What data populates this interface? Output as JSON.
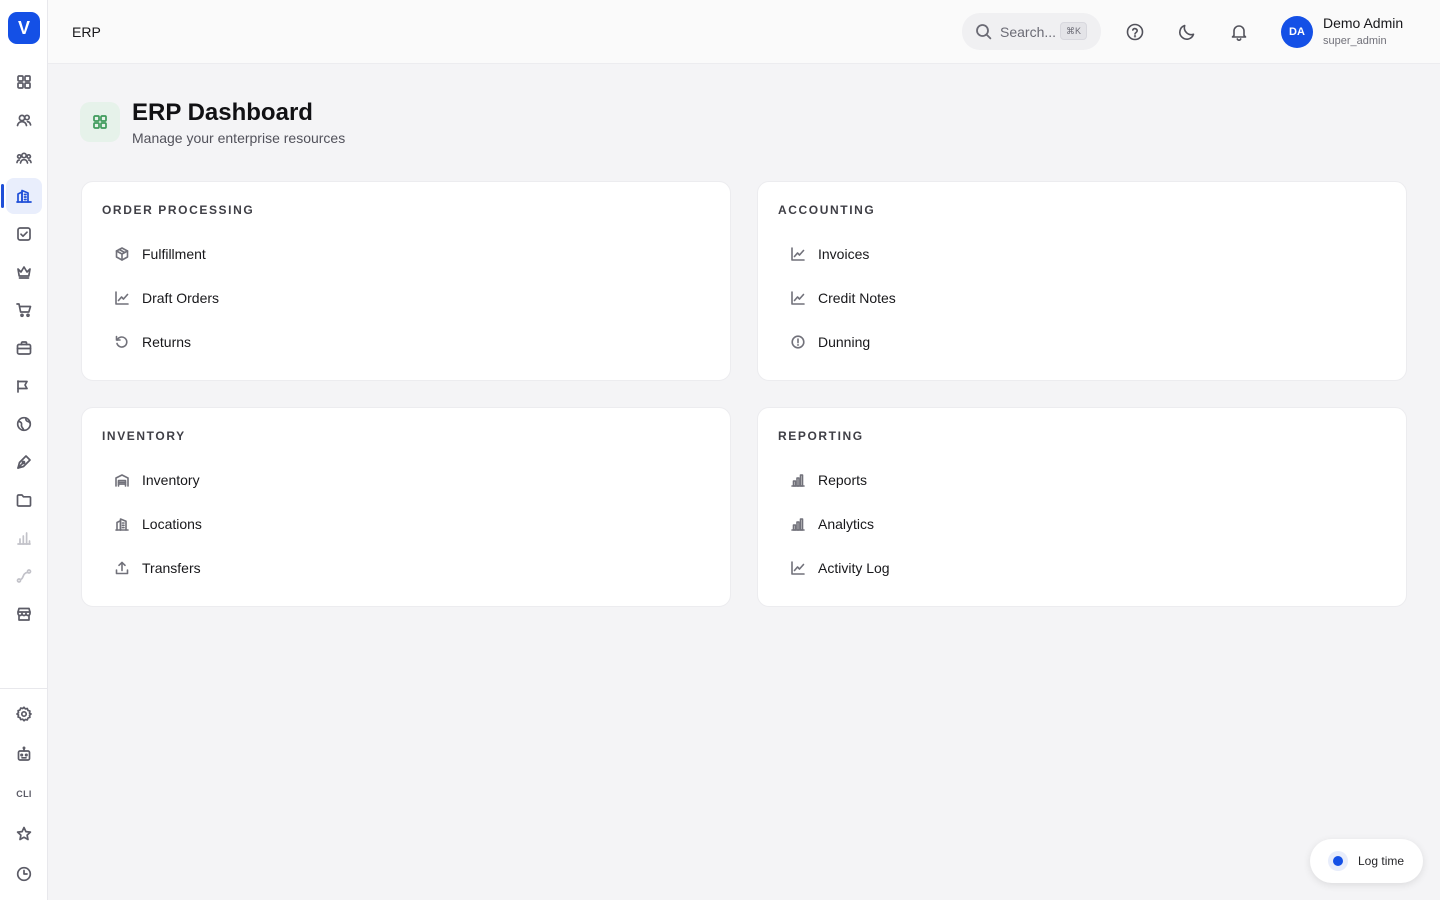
{
  "app": {
    "logo_letter": "V",
    "brand_color": "#1450e6"
  },
  "sidebar": {
    "items": [
      {
        "name": "dashboard",
        "icon": "grid-icon"
      },
      {
        "name": "users",
        "icon": "users-icon"
      },
      {
        "name": "teams",
        "icon": "team-icon"
      },
      {
        "name": "erp",
        "icon": "building-icon",
        "active": true
      },
      {
        "name": "tasks",
        "icon": "checkbox-icon"
      },
      {
        "name": "premium",
        "icon": "crown-icon"
      },
      {
        "name": "shop",
        "icon": "cart-icon"
      },
      {
        "name": "jobs",
        "icon": "briefcase-icon"
      },
      {
        "name": "campaigns",
        "icon": "megaphone-icon"
      },
      {
        "name": "web",
        "icon": "globe-icon"
      },
      {
        "name": "design",
        "icon": "pen-icon"
      },
      {
        "name": "files",
        "icon": "folder-icon"
      },
      {
        "name": "stats",
        "icon": "bar-chart-icon"
      },
      {
        "name": "workflows",
        "icon": "route-icon"
      },
      {
        "name": "store",
        "icon": "store-icon"
      }
    ],
    "bottom": {
      "settings_icon": "gear-icon",
      "bot_icon": "robot-icon",
      "cli_label": "CLI",
      "favorites_icon": "star-icon",
      "history_icon": "clock-icon"
    }
  },
  "header": {
    "title": "ERP",
    "search": {
      "placeholder": "Search...",
      "shortcut": "⌘K"
    },
    "user": {
      "initials": "DA",
      "name": "Demo Admin",
      "role": "super_admin"
    }
  },
  "page": {
    "title": "ERP Dashboard",
    "subtitle": "Manage your enterprise resources",
    "accent": "#3d9a5a"
  },
  "cards": [
    {
      "title": "ORDER PROCESSING",
      "links": [
        {
          "label": "Fulfillment",
          "icon": "package-icon"
        },
        {
          "label": "Draft Orders",
          "icon": "line-chart-icon"
        },
        {
          "label": "Returns",
          "icon": "undo-icon"
        }
      ]
    },
    {
      "title": "ACCOUNTING",
      "links": [
        {
          "label": "Invoices",
          "icon": "line-chart-icon"
        },
        {
          "label": "Credit Notes",
          "icon": "line-chart-icon"
        },
        {
          "label": "Dunning",
          "icon": "alert-circle-icon"
        }
      ]
    },
    {
      "title": "INVENTORY",
      "links": [
        {
          "label": "Inventory",
          "icon": "warehouse-icon"
        },
        {
          "label": "Locations",
          "icon": "building-icon"
        },
        {
          "label": "Transfers",
          "icon": "upload-icon"
        }
      ]
    },
    {
      "title": "REPORTING",
      "links": [
        {
          "label": "Reports",
          "icon": "bar-chart-icon"
        },
        {
          "label": "Analytics",
          "icon": "bar-chart-icon"
        },
        {
          "label": "Activity Log",
          "icon": "line-chart-icon"
        }
      ]
    }
  ],
  "log_time": {
    "label": "Log time"
  }
}
